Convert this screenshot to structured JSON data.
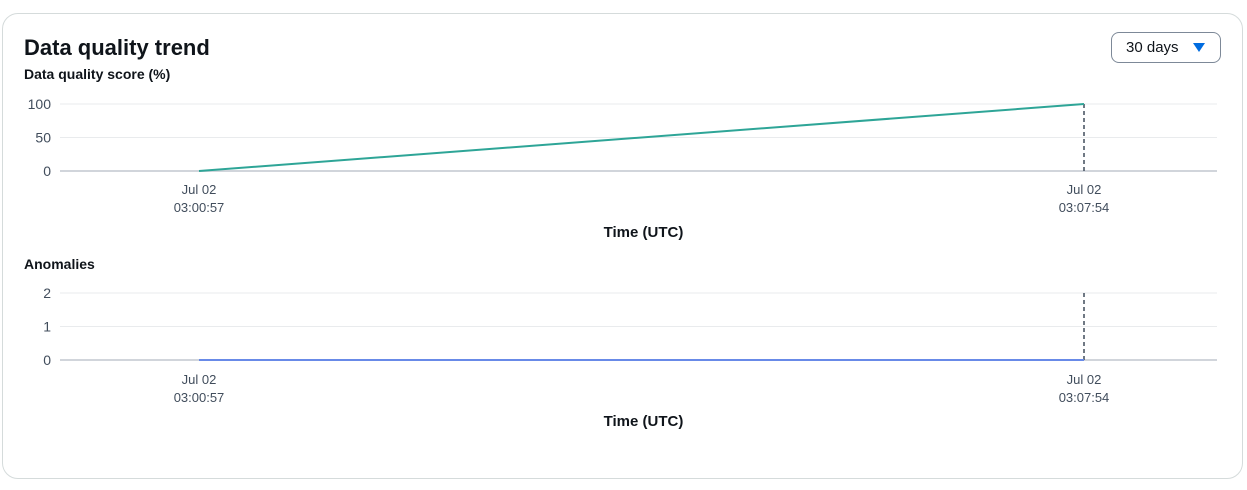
{
  "header": {
    "title": "Data quality trend",
    "range_selector": {
      "value": "30 days"
    }
  },
  "colors": {
    "score_line": "#2ea597",
    "anomaly_line": "#688ae8",
    "grid": "#e9ebed",
    "baseline": "#d1d5db",
    "marker": "#414d5c",
    "accent": "#006ce0"
  },
  "icons": {
    "range_caret": "caret-down-icon"
  },
  "chart_data": [
    {
      "type": "line",
      "title": "Data quality score (%)",
      "xlabel": "Time (UTC)",
      "ylabel": "",
      "x": [
        {
          "date": "Jul 02",
          "time": "03:00:57"
        },
        {
          "date": "Jul 02",
          "time": "03:07:54"
        }
      ],
      "yticks": [
        "100",
        "50",
        "0"
      ],
      "ylim": [
        0,
        100
      ],
      "series": [
        {
          "values": [
            0,
            100
          ]
        }
      ],
      "grid": true
    },
    {
      "type": "line",
      "title": "Anomalies",
      "xlabel": "Time (UTC)",
      "ylabel": "",
      "x": [
        {
          "date": "Jul 02",
          "time": "03:00:57"
        },
        {
          "date": "Jul 02",
          "time": "03:07:54"
        }
      ],
      "yticks": [
        "2",
        "1",
        "0"
      ],
      "ylim": [
        0,
        2
      ],
      "series": [
        {
          "values": [
            0,
            0
          ]
        }
      ],
      "grid": true
    }
  ]
}
